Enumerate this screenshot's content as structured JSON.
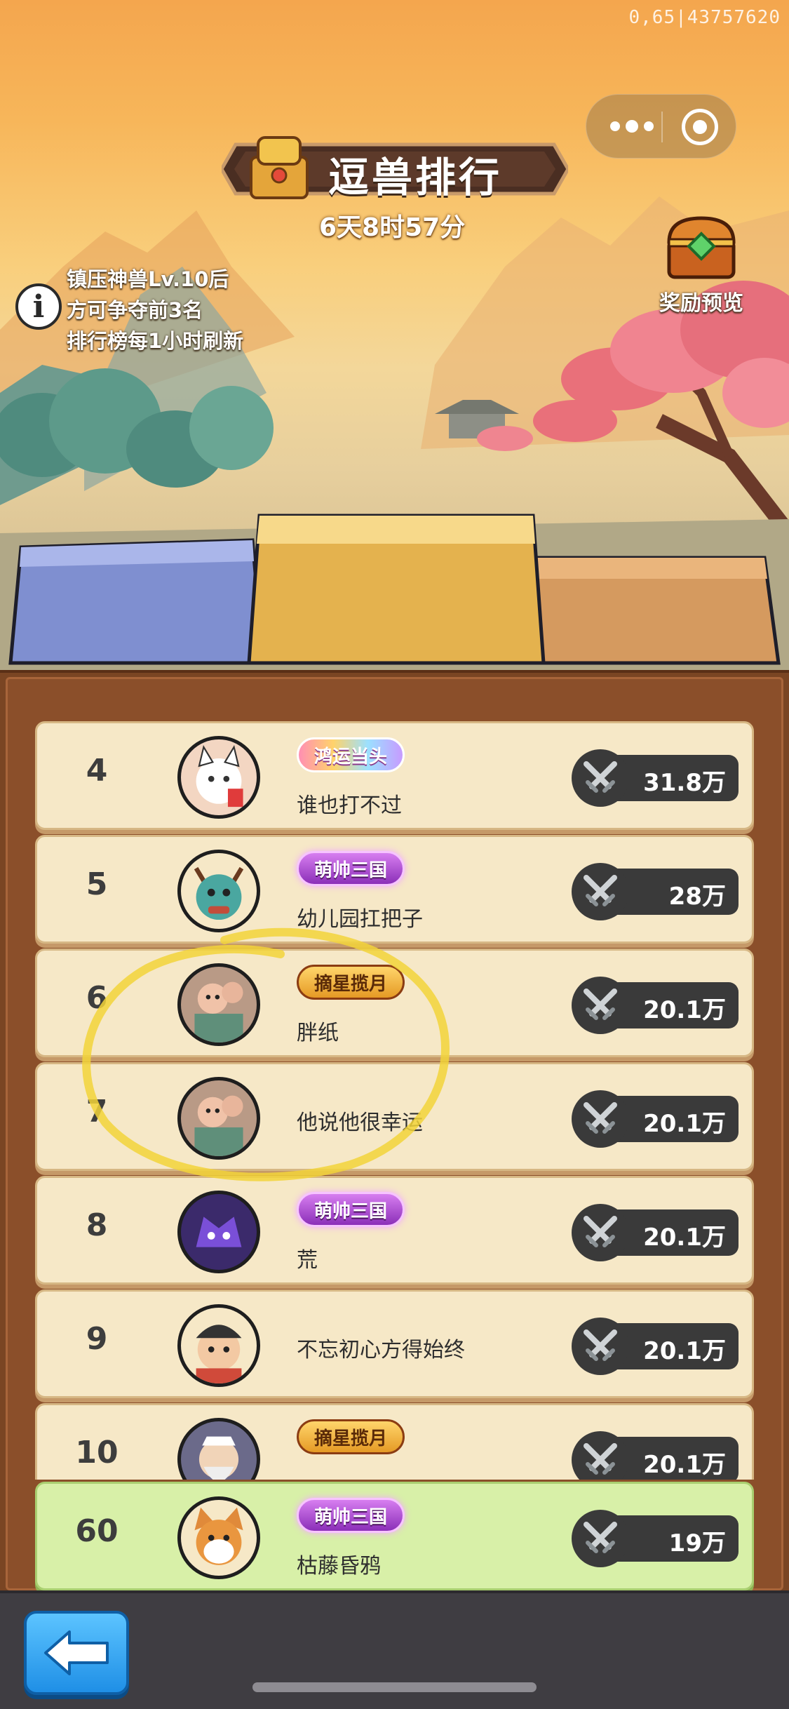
{
  "debug_id": "0,65|43757620",
  "title": "逗兽排行",
  "countdown": "6天8时57分",
  "info_lines": [
    "镇压神兽Lv.10后",
    "方可争夺前3名",
    "排行榜每1小时刷新"
  ],
  "reward_label": "奖励预览",
  "rows": [
    {
      "rank": "4",
      "badge": "鸿运当头",
      "badge_style": "rainbow",
      "name": "谁也打不过",
      "power": "31.8万",
      "avatar": "lucky-cat-avatar"
    },
    {
      "rank": "5",
      "badge": "萌帅三国",
      "badge_style": "purple",
      "name": "幼儿园扛把子",
      "power": "28万",
      "avatar": "deer-warrior-avatar"
    },
    {
      "rank": "6",
      "badge": "摘星揽月",
      "badge_style": "gold",
      "name": "胖纸",
      "power": "20.1万",
      "avatar": "child-photo-avatar"
    },
    {
      "rank": "7",
      "badge": "",
      "badge_style": "",
      "name": "他说他很幸运",
      "power": "20.1万",
      "avatar": "child-photo-avatar"
    },
    {
      "rank": "8",
      "badge": "萌帅三国",
      "badge_style": "purple",
      "name": "荒",
      "power": "20.1万",
      "avatar": "purple-monster-avatar"
    },
    {
      "rank": "9",
      "badge": "",
      "badge_style": "",
      "name": "不忘初心方得始终",
      "power": "20.1万",
      "avatar": "warrior-avatar"
    },
    {
      "rank": "10",
      "badge": "摘星揽月",
      "badge_style": "gold",
      "name": "",
      "power": "20.1万",
      "avatar": "old-sage-avatar"
    }
  ],
  "self_row": {
    "rank": "60",
    "badge": "萌帅三国",
    "badge_style": "purple",
    "name": "枯藤昏鸦",
    "power": "19万",
    "avatar": "shiba-dog-avatar"
  },
  "colors": {
    "row_bg": "#f6e8c7",
    "self_row_bg": "#d8f0a8",
    "panel": "#8b4f2a",
    "accent_blue": "#1f8fe6"
  }
}
